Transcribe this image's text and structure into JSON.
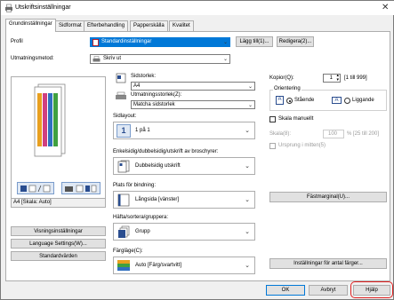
{
  "window": {
    "title": "Utskriftsinställningar"
  },
  "tabs": [
    {
      "label": "Grundinställningar"
    },
    {
      "label": "Sidformat"
    },
    {
      "label": "Efterbehandling"
    },
    {
      "label": "Papperskälla"
    },
    {
      "label": "Kvalitet"
    }
  ],
  "profile": {
    "label": "Profil",
    "value": "Standardinställningar",
    "add_button": "Lägg till(1)...",
    "edit_button": "Redigera(2)..."
  },
  "output_method": {
    "label": "Utmatningsmetod:",
    "value": "Skriv ut"
  },
  "preview": {
    "caption": "A4 [Skala: Auto]",
    "settings_button": "Visningsinställningar",
    "language_button": "Language Settings(W)...",
    "defaults_button": "Standardvärden"
  },
  "page_size": {
    "label": "Sidstorlek:",
    "value": "A4"
  },
  "output_size": {
    "label": "Utmatningsstorlek(Z):",
    "value": "Matcha sidstorlek"
  },
  "copies": {
    "label": "Kopior(Q):",
    "value": "1",
    "range": "[1 till 999]"
  },
  "orientation": {
    "label": "Orientering",
    "portrait": "Stående",
    "landscape": "Liggande",
    "selected": "portrait"
  },
  "layout": {
    "label": "Sidlayout:",
    "value": "1 på 1"
  },
  "scale": {
    "checkbox": "Skala manuellt",
    "label": "Skala(8):",
    "value": "100",
    "unit": "% [25 till 200]"
  },
  "edge": {
    "checkbox": "Ursprung i mitten(5)"
  },
  "duplex": {
    "label": "Enkelsidig/dubbelsidig/utskrift av broschyrer:",
    "value": "Dubbelsidig utskrift"
  },
  "binding": {
    "label": "Plats för bindning:",
    "value": "Långsida [vänster]",
    "margin_button": "Fästmarginal(U)..."
  },
  "finishing": {
    "label": "Häfta/sortera/gruppera:",
    "value": "Grupp"
  },
  "color": {
    "label": "Färgläge(C):",
    "value": "Auto [Färg/svartvitt]",
    "settings_button": "Inställningar för antal färger..."
  },
  "footer": {
    "ok": "OK",
    "cancel": "Avbryt",
    "help": "Hjälp"
  },
  "colors": {
    "accent": "#0078d7",
    "help_highlight": "#e02020"
  }
}
